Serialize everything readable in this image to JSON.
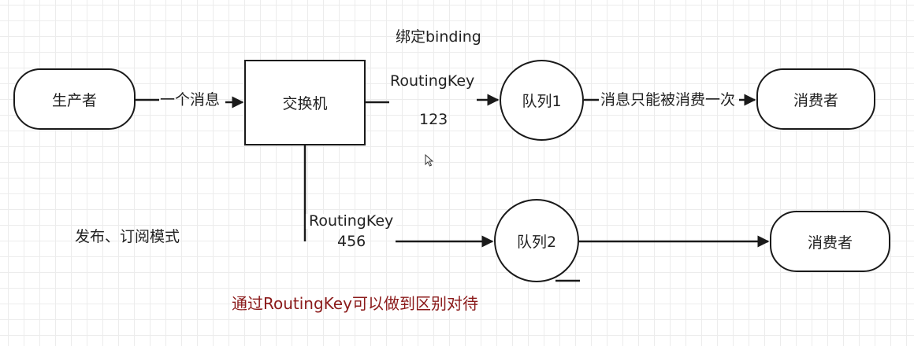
{
  "nodes": {
    "producer": "生产者",
    "exchange": "交换机",
    "queue1": "队列1",
    "queue2": "队列2",
    "consumer1": "消费者",
    "consumer2": "消费者"
  },
  "edges": {
    "producer_to_exchange": "一个消息",
    "queue1_to_consumer": "消息只能被消费一次",
    "binding_title": "绑定binding",
    "routing_key_1": "RoutingKey",
    "routing_key_1_value": "123",
    "routing_key_2": "RoutingKey",
    "routing_key_2_value": "456"
  },
  "notes": {
    "pattern": "发布、订阅模式",
    "summary": "通过RoutingKey可以做到区别对待"
  },
  "colors": {
    "stroke": "#1a1a1a",
    "accent": "#8b1a1a",
    "grid": "#ececec"
  }
}
